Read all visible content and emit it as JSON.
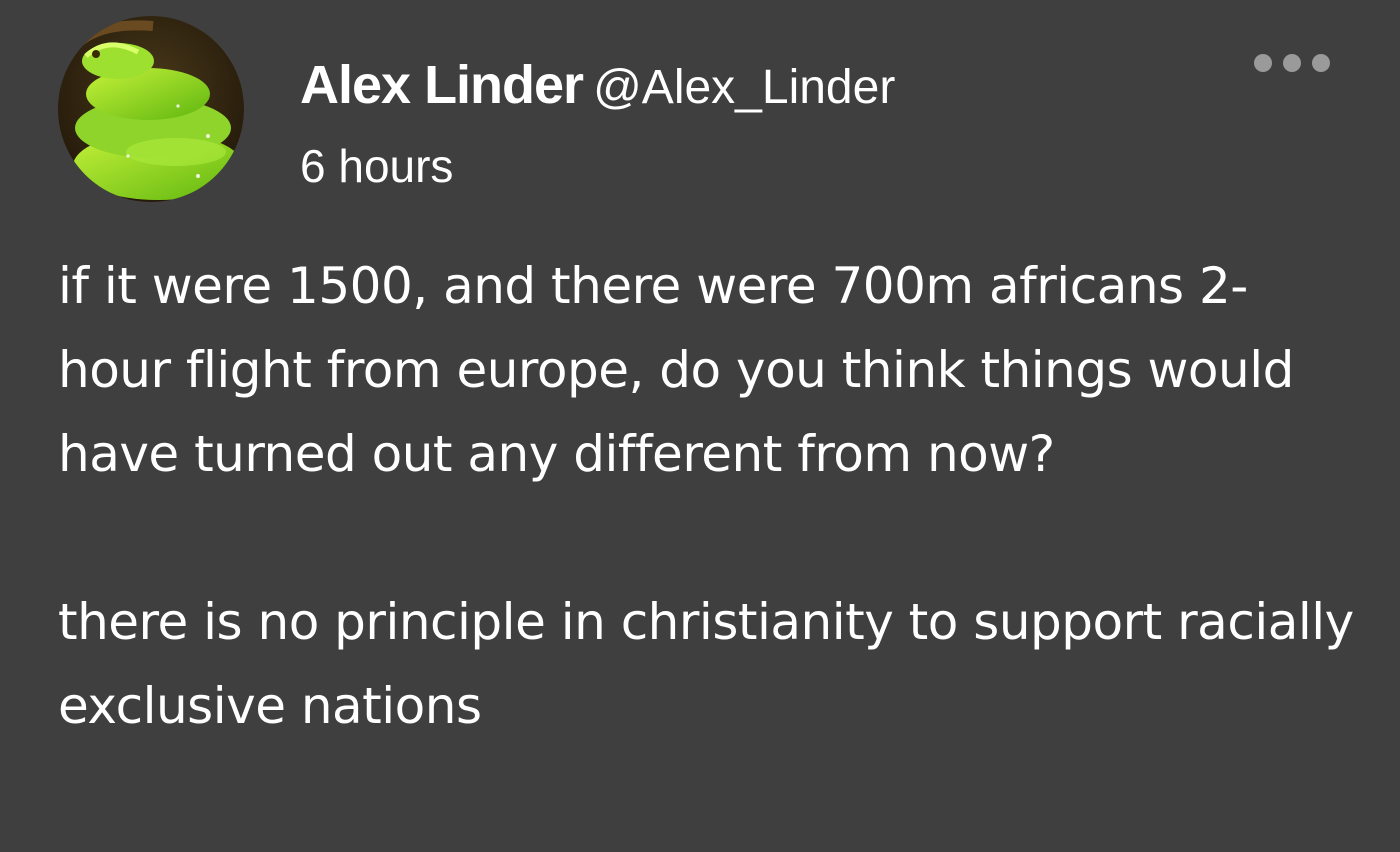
{
  "post": {
    "author": {
      "display_name": "Alex Linder",
      "handle": "@Alex_Linder",
      "avatar_icon": "green-snake-avatar"
    },
    "timestamp": "6 hours",
    "more_icon": "more-options-icon",
    "paragraphs": [
      "if it were 1500, and there were 700m africans 2-hour flight from europe, do you think things would have turned out any different from now?",
      "there is no principle in christianity to support racially exclusive nations"
    ]
  },
  "colors": {
    "background": "#3f3f3f",
    "text": "#ffffff",
    "menu_dots": "#9a9a9a"
  }
}
